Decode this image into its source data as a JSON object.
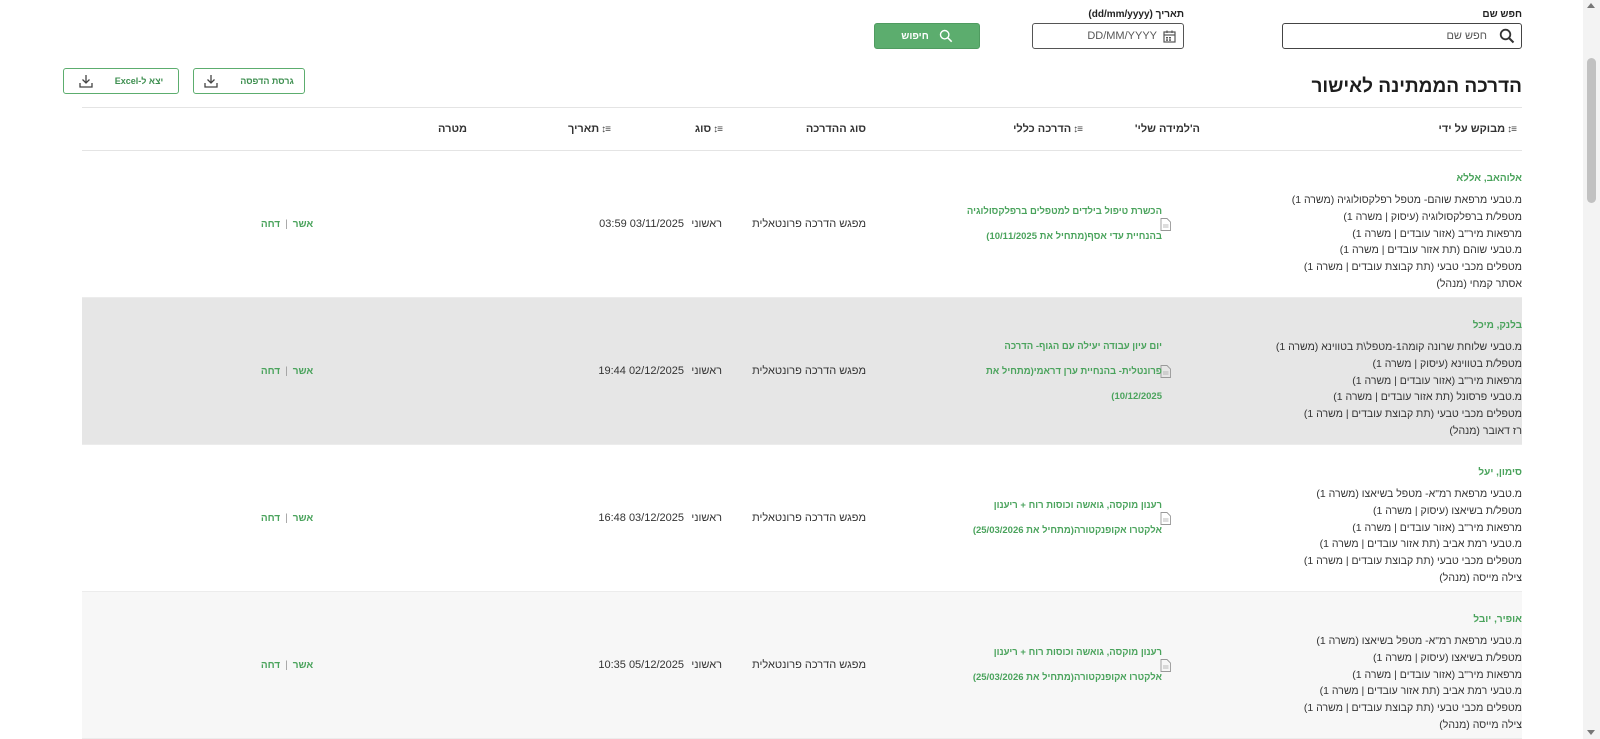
{
  "filters": {
    "name_label": "חפש שם",
    "name_placeholder": "חפש שם",
    "date_label": "תאריך (dd/mm/yyyy)",
    "date_placeholder": "DD/MM/YYYY",
    "search_button": "חיפוש"
  },
  "page_title": "הדרכה הממתינה לאישור",
  "export": {
    "print_label": "גרסת הדפסה",
    "excel_label": "יצא ל-Excel"
  },
  "columns": {
    "requested_by": "מבוקש על ידי",
    "general_training": "הדרכה כללי",
    "my_learning": "ה'למידה שלי'",
    "training_type": "סוג ההדרכה",
    "kind": "סוג",
    "date": "תאריך",
    "target": "מטרה"
  },
  "rows": [
    {
      "name": "אלוהאב, אללא",
      "units": [
        "מ.טבעי מרפאת שוהם- מטפל רפלקסולוגיה (משרה 1)",
        "מטפל/ת ברפלקסולוגיה (עיסוק | משרה 1)",
        "מרפאות מיר\"ב (אזור עובדים | משרה 1)",
        "מ.טבעי שוהם (תת אזור עובדים | משרה 1)",
        "מטפלים מכבי טבעי (תת קבוצת עובדים | משרה 1)",
        "אסתר קמחי (מנהל)"
      ],
      "training": "הכשרת טיפול בילדים למטפלים ברפלקסולוגיה בהנחיית עדי אסף(מתחיל את 10/11/2025)",
      "type": "מפגש הדרכה פרונטאלית",
      "kind": "ראשוני",
      "date": "03/11/2025 03:59",
      "approve": "אשר",
      "reject": "דחה"
    },
    {
      "name": "בלנק, מיכל",
      "units": [
        "מ.טבעי שלוחת שרונה קומה1-מטפל\\ת בטווינא (משרה 1)",
        "מטפל/ת בטווינא (עיסוק | משרה 1)",
        "מרפאות מיר\"ב (אזור עובדים | משרה 1)",
        "מ.טבעי פרסונל (תת אזור עובדים | משרה 1)",
        "מטפלים מכבי טבעי (תת קבוצת עובדים | משרה 1)",
        "רז דאובר (מנהל)"
      ],
      "training": "יום עיון עבודה יעילה עם הגוף- הדרכה פרונטלית- בהנחיית ערן דראמי(מתחיל את 10/12/2025)",
      "type": "מפגש הדרכה פרונטאלית",
      "kind": "ראשוני",
      "date": "02/12/2025 19:44",
      "approve": "אשר",
      "reject": "דחה"
    },
    {
      "name": "סימון, יעל",
      "units": [
        "מ.טבעי מרפאת רמ\"א- מטפל בשיאצו (משרה 1)",
        "מטפל/ת בשיאצו (עיסוק | משרה 1)",
        "מרפאות מיר\"ב (אזור עובדים | משרה 1)",
        "מ.טבעי רמת אביב (תת אזור עובדים | משרה 1)",
        "מטפלים מכבי טבעי (תת קבוצת עובדים | משרה 1)",
        "צילה מייסה (מנהל)"
      ],
      "training": "רענון מוקסה, גואשה וכוסות רוח + ריענון אלקטרו אקופנקטורה(מתחיל את 25/03/2026)",
      "type": "מפגש הדרכה פרונטאלית",
      "kind": "ראשוני",
      "date": "03/12/2025 16:48",
      "approve": "אשר",
      "reject": "דחה"
    },
    {
      "name": "אופיר, יובל",
      "units": [
        "מ.טבעי מרפאת רמ\"א- מטפל בשיאצו (משרה 1)",
        "מטפל/ת בשיאצו (עיסוק | משרה 1)",
        "מרפאות מיר\"ב (אזור עובדים | משרה 1)",
        "מ.טבעי רמת אביב (תת אזור עובדים | משרה 1)",
        "מטפלים מכבי טבעי (תת קבוצת עובדים | משרה 1)",
        "צילה מייסה (מנהל)"
      ],
      "training": "רענון מוקסה, גואשה וכוסות רוח + ריענון אלקטרו אקופנקטורה(מתחיל את 25/03/2026)",
      "type": "מפגש הדרכה פרונטאלית",
      "kind": "ראשוני",
      "date": "05/12/2025 10:35",
      "approve": "אשר",
      "reject": "דחה"
    }
  ],
  "colors": {
    "accent_green": "#5cad6e",
    "link_green": "#4aa35c",
    "alt_row": "#e6e6e6"
  },
  "icons": {
    "search": "search-icon",
    "calendar": "calendar-icon",
    "download": "download-icon",
    "document": "document-icon",
    "sort": "sort-icon"
  }
}
